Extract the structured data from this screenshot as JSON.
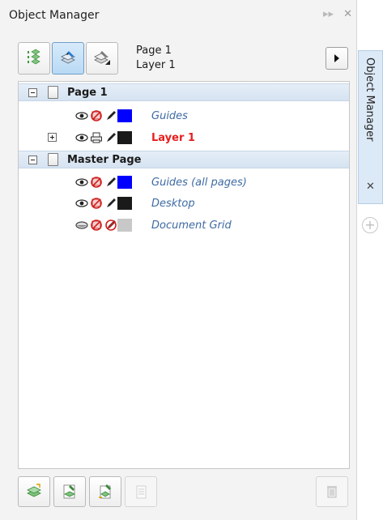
{
  "docker": {
    "title": "Object Manager",
    "actions": {
      "expand_icon": "double-chevron-right-icon",
      "close_icon": "close-icon"
    }
  },
  "toolbar": {
    "buttons": [
      {
        "name": "show-object-properties-button",
        "icon": "layers-properties-icon",
        "active": false
      },
      {
        "name": "edit-across-layers-button",
        "icon": "edit-across-layers-icon",
        "active": true
      },
      {
        "name": "layer-manager-view-button",
        "icon": "layer-manager-view-icon",
        "active": false
      }
    ],
    "current_page": "Page 1",
    "current_layer": "Layer 1",
    "options_button_icon": "triangle-right-icon"
  },
  "tree": {
    "page1": {
      "label": "Page 1",
      "layers": [
        {
          "label": "Guides",
          "style": "italic",
          "color": "#0000ff"
        },
        {
          "label": "Layer 1",
          "style": "red-bold",
          "color": "#1a1a1a"
        }
      ]
    },
    "master": {
      "label": "Master Page",
      "layers": [
        {
          "label": "Guides (all pages)",
          "style": "italic",
          "color": "#0000ff"
        },
        {
          "label": "Desktop",
          "style": "italic",
          "color": "#1a1a1a"
        },
        {
          "label": "Document Grid",
          "style": "italic",
          "color": "#c8c8c8"
        }
      ]
    }
  },
  "bottom_toolbar": {
    "buttons": [
      {
        "name": "new-layer-button",
        "icon": "new-layer-icon",
        "enabled": true
      },
      {
        "name": "new-master-layer-button",
        "icon": "new-master-layer-icon",
        "enabled": true
      },
      {
        "name": "new-master-layer-all-pages-button",
        "icon": "new-master-layer-all-icon",
        "enabled": true
      },
      {
        "name": "new-master-layer-odd-button",
        "icon": "new-master-layer-disabled-icon",
        "enabled": false
      },
      {
        "name": "delete-button",
        "icon": "trash-icon",
        "enabled": false
      }
    ]
  },
  "side_tab": {
    "label": "Object Manager",
    "close": "✕",
    "add_icon": "plus-circle-icon"
  },
  "colors": {
    "header_bg": "#dbe6f3",
    "accent_blue": "#3e6aa4",
    "layer_red": "#e81e1e"
  }
}
